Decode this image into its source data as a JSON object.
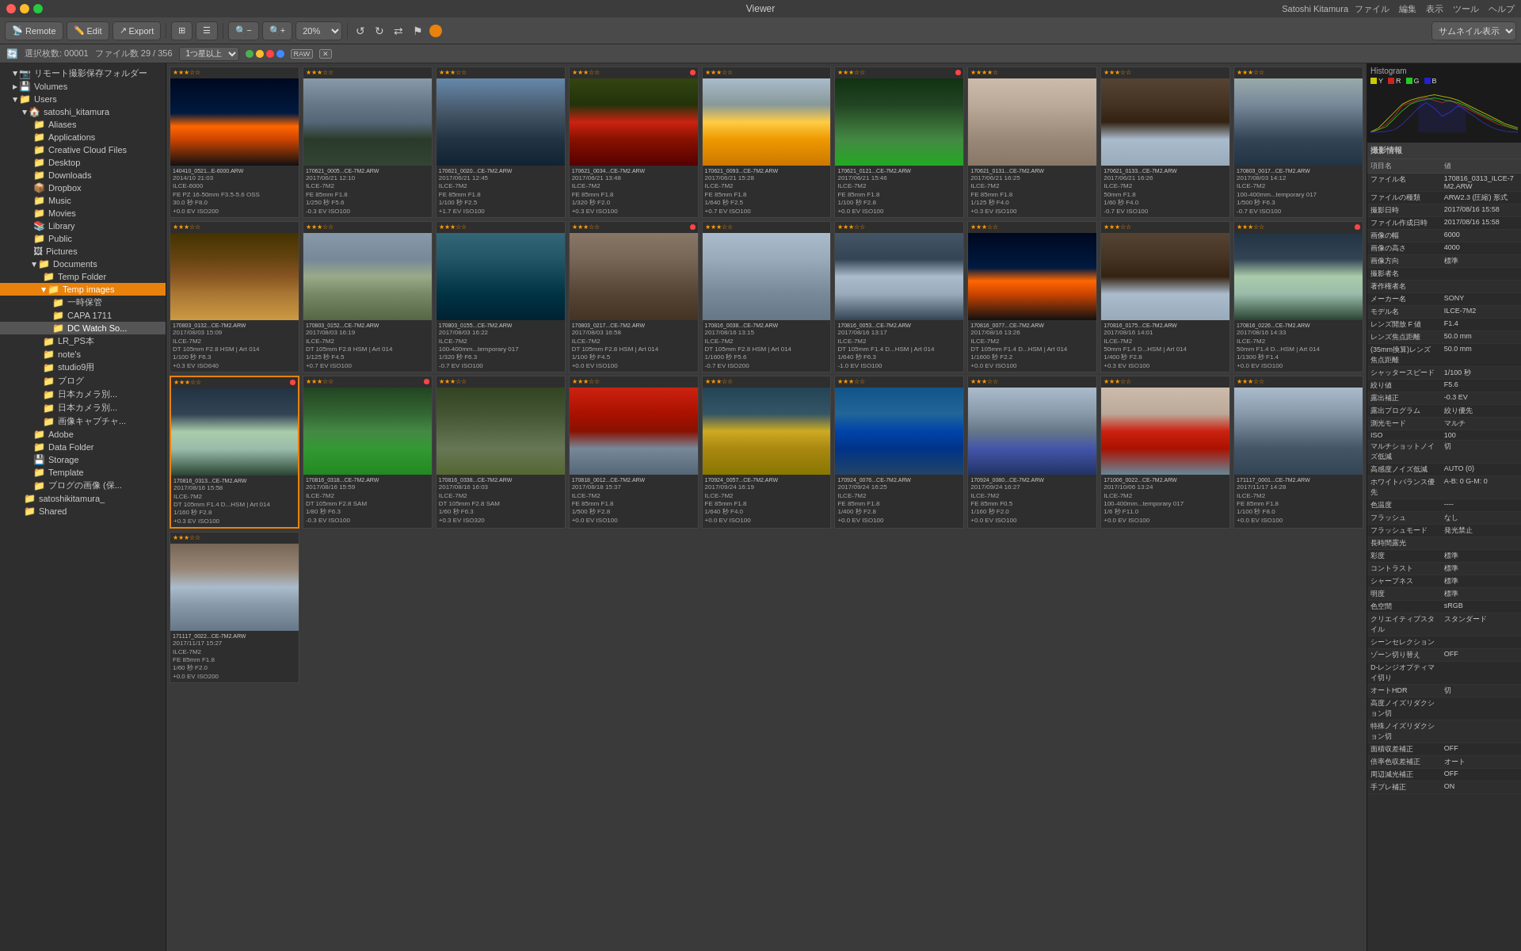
{
  "app": {
    "title": "Viewer",
    "menu": [
      "ファイル",
      "編集",
      "表示",
      "ツール",
      "ヘルプ"
    ]
  },
  "toolbar": {
    "remote_label": "Remote",
    "edit_label": "Edit",
    "export_label": "Export",
    "zoom_level": "20%",
    "view_select": "サムネイル表示"
  },
  "status": {
    "selected": "選択枚数: 00001",
    "file_count": "ファイル数 29 / 356",
    "filter_select": "1つ星以上"
  },
  "histogram": {
    "title": "Histogram",
    "legend": [
      "Y",
      "R",
      "G",
      "B"
    ]
  },
  "properties": {
    "section_title": "撮影情報",
    "col_key": "項目名",
    "col_val": "値",
    "rows": [
      [
        "ファイル名",
        "170816_0313_ILCE-7M2.ARW"
      ],
      [
        "ファイルの種類",
        "ARW2.3 (圧縮) 形式"
      ],
      [
        "撮影日時",
        "2017/08/16 15:58"
      ],
      [
        "ファイル作成日時",
        "2017/08/16 15:58"
      ],
      [
        "画像の幅",
        "6000"
      ],
      [
        "画像の高さ",
        "4000"
      ],
      [
        "画像方向",
        "標準"
      ],
      [
        "撮影者名",
        ""
      ],
      [
        "著作権者名",
        ""
      ],
      [
        "メーカー名",
        "SONY"
      ],
      [
        "モデル名",
        "ILCE-7M2"
      ],
      [
        "レンズ開放 F 値",
        "F1.4"
      ],
      [
        "レンズ焦点距離",
        "50.0 mm"
      ],
      [
        "(35mm換算)レンズ焦点距離",
        "50.0 mm"
      ],
      [
        "シャッタースピード",
        "1/100 秒"
      ],
      [
        "絞り値",
        "F5.6"
      ],
      [
        "露出補正",
        "-0.3 EV"
      ],
      [
        "露出プログラム",
        "絞り優先"
      ],
      [
        "測光モード",
        "マルチ"
      ],
      [
        "ISO",
        "100"
      ],
      [
        "マルチショットノイズ低減",
        "切"
      ],
      [
        "高感度ノイズ低減",
        "AUTO (0)"
      ],
      [
        "ホワイトバランス優先",
        "A-B: 0 G-M: 0"
      ],
      [
        "色温度",
        "----"
      ],
      [
        "フラッシュ",
        "なし"
      ],
      [
        "フラッシュモード",
        "発光禁止"
      ],
      [
        "長時間露光",
        ""
      ],
      [
        "彩度",
        "標準"
      ],
      [
        "コントラスト",
        "標準"
      ],
      [
        "シャープネス",
        "標準"
      ],
      [
        "明度",
        "標準"
      ],
      [
        "色空間",
        "sRGB"
      ],
      [
        "クリエイティブスタイル",
        "スタンダード"
      ],
      [
        "シーンセレクション",
        ""
      ],
      [
        "ゾーン切り替え",
        "OFF"
      ],
      [
        "D-レンジオプティマイ切り",
        ""
      ],
      [
        "オートHDR",
        "切"
      ],
      [
        "高度ノイズリダクション切",
        ""
      ],
      [
        "特殊ノイズリダクション切",
        ""
      ],
      [
        "面積収差補正",
        "OFF"
      ],
      [
        "倍率色収差補正",
        "オート"
      ],
      [
        "周辺減光補正",
        "OFF"
      ],
      [
        "手ブレ補正",
        "ON"
      ]
    ]
  },
  "sidebar": {
    "items": [
      {
        "id": "remote-folder",
        "label": "リモート撮影保存フォルダー",
        "indent": 1,
        "icon": "📷",
        "open": true
      },
      {
        "id": "volumes",
        "label": "Volumes",
        "indent": 1,
        "icon": "💾",
        "open": false
      },
      {
        "id": "users",
        "label": "Users",
        "indent": 1,
        "icon": "📁",
        "open": true
      },
      {
        "id": "satoshi",
        "label": "satoshi_kitamura",
        "indent": 2,
        "icon": "🏠",
        "open": true
      },
      {
        "id": "aliases",
        "label": "Aliases",
        "indent": 3,
        "icon": "📁"
      },
      {
        "id": "applications",
        "label": "Applications",
        "indent": 3,
        "icon": "📁"
      },
      {
        "id": "cc-files",
        "label": "Creative Cloud Files",
        "indent": 3,
        "icon": "📁"
      },
      {
        "id": "desktop",
        "label": "Desktop",
        "indent": 3,
        "icon": "📁"
      },
      {
        "id": "downloads",
        "label": "Downloads",
        "indent": 3,
        "icon": "📁"
      },
      {
        "id": "dropbox",
        "label": "Dropbox",
        "indent": 3,
        "icon": "📦"
      },
      {
        "id": "music",
        "label": "Music",
        "indent": 3,
        "icon": "📁"
      },
      {
        "id": "movies",
        "label": "Movies",
        "indent": 3,
        "icon": "📁"
      },
      {
        "id": "library",
        "label": "Library",
        "indent": 3,
        "icon": "📚"
      },
      {
        "id": "public",
        "label": "Public",
        "indent": 3,
        "icon": "📁"
      },
      {
        "id": "pictures",
        "label": "Pictures",
        "indent": 3,
        "icon": "🖼"
      },
      {
        "id": "documents",
        "label": "Documents",
        "indent": 3,
        "icon": "📁",
        "open": true
      },
      {
        "id": "temp-folder",
        "label": "Temp Folder",
        "indent": 4,
        "icon": "📁"
      },
      {
        "id": "temp-images",
        "label": "Temp images",
        "indent": 4,
        "icon": "📁",
        "open": true,
        "active": true
      },
      {
        "id": "ichiji",
        "label": "一時保管",
        "indent": 5,
        "icon": "📁"
      },
      {
        "id": "capa",
        "label": "CAPA 1711",
        "indent": 5,
        "icon": "📁"
      },
      {
        "id": "dc-watch",
        "label": "DC Watch So...",
        "indent": 5,
        "icon": "📁",
        "selected": true
      },
      {
        "id": "lrps",
        "label": "LR_PS本",
        "indent": 4,
        "icon": "📁"
      },
      {
        "id": "notes",
        "label": "note's",
        "indent": 4,
        "icon": "📁"
      },
      {
        "id": "studio9",
        "label": "studio9用",
        "indent": 4,
        "icon": "📁"
      },
      {
        "id": "blog",
        "label": "ブログ",
        "indent": 4,
        "icon": "📁"
      },
      {
        "id": "japancam1",
        "label": "日本カメラ別...",
        "indent": 4,
        "icon": "📁"
      },
      {
        "id": "japancam2",
        "label": "日本カメラ別...",
        "indent": 4,
        "icon": "📁"
      },
      {
        "id": "gazo-cap",
        "label": "画像キャプチャ...",
        "indent": 4,
        "icon": "📁"
      },
      {
        "id": "adobe",
        "label": "Adobe",
        "indent": 3,
        "icon": "📁"
      },
      {
        "id": "data-folder",
        "label": "Data Folder",
        "indent": 3,
        "icon": "📁"
      },
      {
        "id": "storage",
        "label": "Storage",
        "indent": 3,
        "icon": "💾"
      },
      {
        "id": "template",
        "label": "Template",
        "indent": 3,
        "icon": "📁"
      },
      {
        "id": "blog-img",
        "label": "ブログの画像 (保...",
        "indent": 3,
        "icon": "📁"
      },
      {
        "id": "satoshikitamura",
        "label": "satoshikitamura_",
        "indent": 2,
        "icon": "📁"
      },
      {
        "id": "shared",
        "label": "Shared",
        "indent": 2,
        "icon": "📁"
      }
    ]
  },
  "thumbnails": [
    {
      "id": 1,
      "title": "140410_0521...E-6000.ARW",
      "date": "2014/10 21:03",
      "camera": "ILCE-6000",
      "lens": "FE PZ 16-50mm F3.5-5.6 OSS",
      "shutter": "30.0 秒 F8.0",
      "ev": "+0.0 EV ISO200",
      "stars": 3,
      "class": "city-night"
    },
    {
      "id": 2,
      "title": "170621_0005...CE-7M2.ARW",
      "date": "2017/06/21 12:10",
      "camera": "ILCE-7M2",
      "lens": "FE 85mm F1.8",
      "shutter": "1/250 秒 F5.6",
      "ev": "-0.3 EV ISO100",
      "stars": 3,
      "class": "temple"
    },
    {
      "id": 3,
      "title": "170621_0020...CE-7M2.ARW",
      "date": "2017/06/21 12:45",
      "camera": "ILCE-7M2",
      "lens": "FE 85mm F1.8",
      "shutter": "1/100 秒 F2.5",
      "ev": "+1.7 EV ISO100",
      "stars": 3,
      "class": "pigeon"
    },
    {
      "id": 4,
      "title": "170621_0034...CE-7M2.ARW",
      "date": "2017/06/21 13:48",
      "camera": "ILCE-7M2",
      "lens": "FE 85mm F1.8",
      "shutter": "1/320 秒 F2.0",
      "ev": "+0.3 EV ISO100",
      "stars": 3,
      "class": "red-leaves",
      "label": "red"
    },
    {
      "id": 5,
      "title": "170621_0093...CE-7M2.ARW",
      "date": "2017/06/21 15:28",
      "camera": "ILCE-7M2",
      "lens": "FE 85mm F1.8",
      "shutter": "1/640 秒 F2.5",
      "ev": "+0.7 EV ISO100",
      "stars": 3,
      "class": "roses"
    },
    {
      "id": 6,
      "title": "170621_0121...CE-7M2.ARW",
      "date": "2017/06/21 15:46",
      "camera": "ILCE-7M2",
      "lens": "FE 85mm F1.8",
      "shutter": "1/100 秒 F2.8",
      "ev": "+0.0 EV ISO100",
      "stars": 3,
      "class": "green-leaves",
      "label": "red"
    },
    {
      "id": 7,
      "title": "170621_0131...CE-7M2.ARW",
      "date": "2017/06/21 16:25",
      "camera": "ILCE-7M2",
      "lens": "FE 85mm F1.8",
      "shutter": "1/125 秒 F4.0",
      "ev": "+0.3 EV ISO100",
      "stars": 4,
      "class": "building"
    },
    {
      "id": 8,
      "title": "170621_0133...CE-7M2.ARW",
      "date": "2017/06/21 16:26",
      "camera": "ILCE-7M2",
      "lens": "50mm F1.8",
      "shutter": "1/60 秒 F4.0",
      "ev": "-0.7 EV ISO100",
      "stars": 3,
      "class": "chairs"
    },
    {
      "id": 9,
      "title": "170803_0017...CE-7M2.ARW",
      "date": "2017/08/03 14:12",
      "camera": "ILCE-7M2",
      "lens": "100-400mm...temporary 017",
      "shutter": "1/500 秒 F6.3",
      "ev": "-0.7 EV ISO100",
      "stars": 3,
      "class": "stone-path"
    },
    {
      "id": 10,
      "title": "170803_0132...CE-7M2.ARW",
      "date": "2017/08/03 15:09",
      "camera": "ILCE-7M2",
      "lens": "DT 105mm F2.8 HSM | Art 014",
      "shutter": "1/100 秒 F6.3",
      "ev": "+0.3 EV ISO640",
      "stars": 3,
      "class": "autumn-road"
    },
    {
      "id": 11,
      "title": "170803_0152...CE-7M2.ARW",
      "date": "2017/08/03 16:19",
      "camera": "ILCE-7M2",
      "lens": "DT 105mm F2.8 HSM | Art 014",
      "shutter": "1/125 秒 F4.5",
      "ev": "+0.7 EV ISO100",
      "stars": 3,
      "class": "door-arch"
    },
    {
      "id": 12,
      "title": "170803_0155...CE-7M2.ARW",
      "date": "2017/08/03 16:22",
      "camera": "ILCE-7M2",
      "lens": "100-400mm...temporary 017",
      "shutter": "1/320 秒 F6.3",
      "ev": "-0.7 EV ISO100",
      "stars": 3,
      "class": "teal-wall"
    },
    {
      "id": 13,
      "title": "170803_0217...CE-7M2.ARW",
      "date": "2017/08/03 16:58",
      "camera": "ILCE-7M2",
      "lens": "DT 105mm F2.8 HSM | Art 014",
      "shutter": "1/100 秒 F4.5",
      "ev": "+0.0 EV ISO100",
      "stars": 3,
      "class": "wooden-door",
      "label": "red"
    },
    {
      "id": 14,
      "title": "170816_0038...CE-7M2.ARW",
      "date": "2017/08/16 13:15",
      "camera": "ILCE-7M2",
      "lens": "DT 105mm F2.8 HSM | Art 014",
      "shutter": "1/1600 秒 F5.6",
      "ev": "-0.7 EV ISO200",
      "stars": 3,
      "class": "ruin-building"
    },
    {
      "id": 15,
      "title": "170816_0053...CE-7M2.ARW",
      "date": "2017/08/16 13:17",
      "camera": "ILCE-7M2",
      "lens": "DT 105mm F1.4 D...HSM | Art 014",
      "shutter": "1/640 秒 F6.3",
      "ev": "-1.0 EV ISO100",
      "stars": 3,
      "class": "riverside"
    },
    {
      "id": 16,
      "title": "170816_0077...CE-7M2.ARW",
      "date": "2017/08/16 13:26",
      "camera": "ILCE-7M2",
      "lens": "DT 105mm F1.4 D...HSM | Art 014",
      "shutter": "1/1600 秒 F2.2",
      "ev": "+0.0 EV ISO100",
      "stars": 3,
      "class": "city-night"
    },
    {
      "id": 17,
      "title": "170816_0175...CE-7M2.ARW",
      "date": "2017/08/16 14:01",
      "camera": "ILCE-7M2",
      "lens": "50mm F1.4 D...HSM | Art 014",
      "shutter": "1/400 秒 F2.8",
      "ev": "+0.3 EV ISO100",
      "stars": 3,
      "class": "chairs"
    },
    {
      "id": 18,
      "title": "170816_0226...CE-7M2.ARW",
      "date": "2017/08/16 14:33",
      "camera": "ILCE-7M2",
      "lens": "50mm F1.4 D...HSM | Art 014",
      "shutter": "1/1300 秒 F1.4",
      "ev": "+0.0 EV ISO100",
      "stars": 3,
      "class": "stream",
      "label": "red"
    },
    {
      "id": 19,
      "title": "170816_0313...CE-7M2.ARW",
      "date": "2017/08/16 15:58",
      "camera": "ILCE-7M2",
      "lens": "DT 105mm F1.4 D...HSM | Art 014",
      "shutter": "1/160 秒 F2.8",
      "ev": "+0.3 EV ISO100",
      "stars": 3,
      "class": "stream",
      "selected": true,
      "label": "red"
    },
    {
      "id": 20,
      "title": "170816_0318...CE-7M2.ARW",
      "date": "2017/08/16 15:59",
      "camera": "ILCE-7M2",
      "lens": "DT 105mm F2.8 SAM",
      "shutter": "1/80 秒 F6.3",
      "ev": "-0.3 EV ISO100",
      "stars": 3,
      "class": "forest",
      "label": "red"
    },
    {
      "id": 21,
      "title": "170816_0338...CE-7M2.ARW",
      "date": "2017/08/16 16:03",
      "camera": "ILCE-7M2",
      "lens": "DT 105mm F2.8 SAM",
      "shutter": "1/60 秒 F6.3",
      "ev": "+0.3 EV ISO320",
      "stars": 3,
      "class": "wooded-path"
    },
    {
      "id": 22,
      "title": "170818_0012...CE-7M2.ARW",
      "date": "2017/08/18 15:37",
      "camera": "ILCE-7M2",
      "lens": "FE 85mm F1.8",
      "shutter": "1/500 秒 F2.8",
      "ev": "+0.0 EV ISO100",
      "stars": 3,
      "class": "mailbox"
    },
    {
      "id": 23,
      "title": "170924_0057...CE-7M2.ARW",
      "date": "2017/09/24 16:19",
      "camera": "ILCE-7M2",
      "lens": "FE 85mm F1.8",
      "shutter": "1/640 秒 F4.0",
      "ev": "+0.0 EV ISO100",
      "stars": 3,
      "class": "boats"
    },
    {
      "id": 24,
      "title": "170924_0076...CE-7M2.ARW",
      "date": "2017/09/24 16:25",
      "camera": "ILCE-7M2",
      "lens": "FE 85mm F1.8",
      "shutter": "1/400 秒 F2.8",
      "ev": "+0.0 EV ISO100",
      "stars": 3,
      "class": "kayak"
    },
    {
      "id": 25,
      "title": "170924_0080...CE-7M2.ARW",
      "date": "2017/09/24 16:27",
      "camera": "ILCE-7M2",
      "lens": "FE 85mm F0.5",
      "shutter": "1/160 秒 F2.0",
      "ev": "+0.0 EV ISO100",
      "stars": 3,
      "class": "alley"
    },
    {
      "id": 26,
      "title": "171006_0022...CE-7M2.ARW",
      "date": "2017/10/06 13:24",
      "camera": "ILCE-7M2",
      "lens": "100-400mm...temporary 017",
      "shutter": "1/6 秒 F11.0",
      "ev": "+0.0 EV ISO100",
      "stars": 3,
      "class": "red-box"
    },
    {
      "id": 27,
      "title": "171117_0001...CE-7M2.ARW",
      "date": "2017/11/17 14:28",
      "camera": "ILCE-7M2",
      "lens": "FE 85mm F1.8",
      "shutter": "1/100 秒 F8.0",
      "ev": "+0.0 EV ISO100",
      "stars": 3,
      "class": "statue"
    },
    {
      "id": 28,
      "title": "171117_0022...CE-7M2.ARW",
      "date": "2017/11/17 15:27",
      "camera": "ILCE-7M2",
      "lens": "FE 85mm F1.8",
      "shutter": "1/60 秒 F2.0",
      "ev": "+0.0 EV ISO200",
      "stars": 3,
      "class": "buddha"
    }
  ],
  "user": {
    "name": "Satoshi Kitamura"
  }
}
